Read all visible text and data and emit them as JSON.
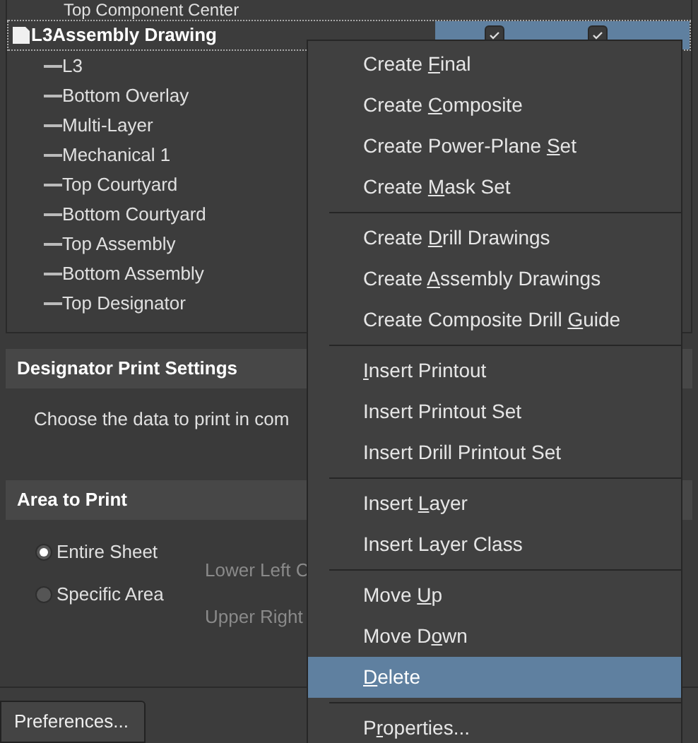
{
  "tree": {
    "cut_item": "Top Component Center",
    "root": {
      "label": "L3Assembly Drawing",
      "selected": true,
      "checks": [
        {
          "checked": true
        },
        {
          "checked": true
        }
      ],
      "children": [
        {
          "label": "L3"
        },
        {
          "label": "Bottom Overlay"
        },
        {
          "label": "Multi-Layer"
        },
        {
          "label": "Mechanical 1"
        },
        {
          "label": "Top Courtyard"
        },
        {
          "label": "Bottom Courtyard"
        },
        {
          "label": "Top Assembly"
        },
        {
          "label": "Bottom Assembly"
        },
        {
          "label": "Top Designator"
        }
      ]
    }
  },
  "designator_section": {
    "title": "Designator Print Settings",
    "text": "Choose the data to print in com"
  },
  "area_section": {
    "title": "Area to Print",
    "options": [
      {
        "label": "Entire Sheet",
        "selected": true
      },
      {
        "label": "Specific Area",
        "selected": false
      }
    ],
    "coords": [
      {
        "label": "Lower Left C",
        "disabled": true
      },
      {
        "label": "Upper Right",
        "disabled": true
      }
    ]
  },
  "preferences_button": "Preferences...",
  "context_menu": [
    [
      {
        "before": "Create ",
        "key": "F",
        "after": "inal",
        "selected": false
      },
      {
        "before": "Create ",
        "key": "C",
        "after": "omposite",
        "selected": false
      },
      {
        "before": "Create Power-Plane ",
        "key": "S",
        "after": "et",
        "selected": false
      },
      {
        "before": "Create ",
        "key": "M",
        "after": "ask Set",
        "selected": false
      }
    ],
    [
      {
        "before": "Create ",
        "key": "D",
        "after": "rill Drawings",
        "selected": false
      },
      {
        "before": "Create ",
        "key": "A",
        "after": "ssembly Drawings",
        "selected": false
      },
      {
        "before": "Create Composite Drill ",
        "key": "G",
        "after": "uide",
        "selected": false
      }
    ],
    [
      {
        "key": "I",
        "after": "nsert Printout",
        "selected": false
      },
      {
        "before": "Insert Printout Set",
        "selected": false
      },
      {
        "before": "Insert Drill Printout Set",
        "selected": false
      }
    ],
    [
      {
        "before": "Insert ",
        "key": "L",
        "after": "ayer",
        "selected": false
      },
      {
        "before": "Insert Layer Class",
        "selected": false
      }
    ],
    [
      {
        "before": "Move ",
        "key": "U",
        "after": "p",
        "selected": false
      },
      {
        "before": "Move D",
        "key": "o",
        "after": "wn",
        "selected": false
      },
      {
        "key": "D",
        "after": "elete",
        "selected": true
      }
    ],
    [
      {
        "before": "P",
        "key": "r",
        "after": "operties...",
        "selected": false
      }
    ]
  ]
}
